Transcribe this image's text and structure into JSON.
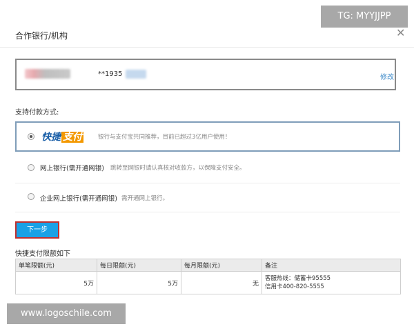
{
  "dialog": {
    "title": "合作银行/机构",
    "close_icon": "close-icon"
  },
  "bank_card": {
    "card_number": "**1935",
    "modify_label": "修改"
  },
  "payment": {
    "label": "支持付款方式:",
    "options": [
      {
        "logo_text_main": "快捷",
        "logo_text_accent": "支付",
        "description": "银行与支付宝共同推荐，目前已超过3亿用户使用！",
        "selected": true
      },
      {
        "name": "网上银行(需开通网银)",
        "description": "跳转至网银时请认真核对收款方，以保障支付安全。",
        "selected": false
      },
      {
        "name": "企业网上银行(需开通网银)",
        "description": "需开通网上银行。",
        "selected": false
      }
    ]
  },
  "next_button_label": "下一步",
  "limits": {
    "title": "快捷支付限额如下",
    "headers": [
      "单笔限额(元)",
      "每日限额(元)",
      "每月限额(元)",
      "备注"
    ],
    "row": {
      "single": "5万",
      "daily": "5万",
      "monthly": "无",
      "note_line1": "客服热线：储蓄卡95555",
      "note_line2": "信用卡400-820-5555"
    }
  },
  "watermarks": {
    "top": "TG: MYYJJPP",
    "bottom": "www.logoschile.com"
  },
  "colors": {
    "link": "#3a88c8",
    "button": "#19a1e6",
    "button_border": "#c0302e",
    "selected_border": "#7f9db9",
    "logo_blue": "#1a5fa8",
    "logo_orange": "#f39800"
  }
}
